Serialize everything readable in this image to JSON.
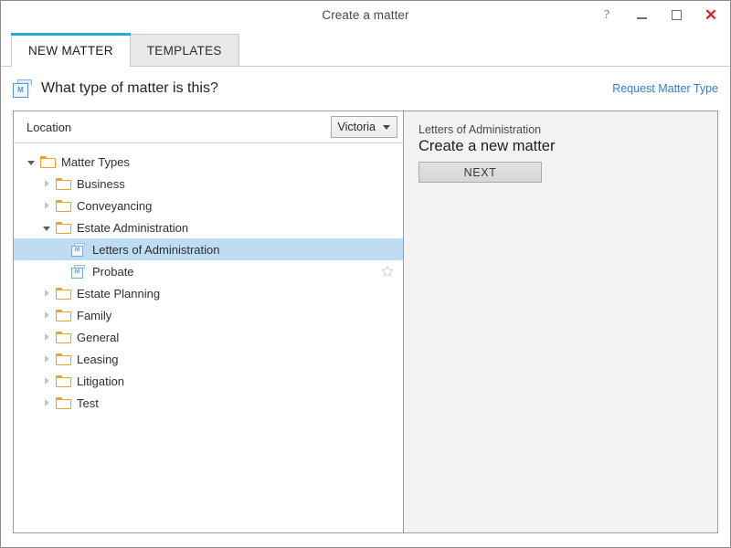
{
  "window": {
    "title": "Create a matter",
    "buttons": {
      "help": "?",
      "minimize": "–",
      "maximize": "□",
      "close": "✕"
    }
  },
  "tabs": [
    {
      "label": "NEW MATTER",
      "active": true
    },
    {
      "label": "TEMPLATES",
      "active": false
    }
  ],
  "header": {
    "icon": "matter-type-icon",
    "icon_letter": "M",
    "title": "What type of matter is this?",
    "link": "Request Matter Type"
  },
  "location": {
    "label": "Location",
    "value": "Victoria"
  },
  "tree": [
    {
      "label": "Matter Types",
      "depth": 0,
      "kind": "folder",
      "state": "expanded",
      "selected": false,
      "star": false
    },
    {
      "label": "Business",
      "depth": 1,
      "kind": "folder",
      "state": "collapsed",
      "selected": false,
      "star": false
    },
    {
      "label": "Conveyancing",
      "depth": 1,
      "kind": "folder",
      "state": "collapsed",
      "selected": false,
      "star": false
    },
    {
      "label": "Estate Administration",
      "depth": 1,
      "kind": "folder",
      "state": "expanded",
      "selected": false,
      "star": false
    },
    {
      "label": "Letters of Administration",
      "depth": 2,
      "kind": "matter",
      "state": "leaf",
      "selected": true,
      "star": true
    },
    {
      "label": "Probate",
      "depth": 2,
      "kind": "matter",
      "state": "leaf",
      "selected": false,
      "star": true
    },
    {
      "label": "Estate Planning",
      "depth": 1,
      "kind": "folder",
      "state": "collapsed",
      "selected": false,
      "star": false
    },
    {
      "label": "Family",
      "depth": 1,
      "kind": "folder",
      "state": "collapsed",
      "selected": false,
      "star": false
    },
    {
      "label": "General",
      "depth": 1,
      "kind": "folder",
      "state": "collapsed",
      "selected": false,
      "star": false
    },
    {
      "label": "Leasing",
      "depth": 1,
      "kind": "folder",
      "state": "collapsed",
      "selected": false,
      "star": false
    },
    {
      "label": "Litigation",
      "depth": 1,
      "kind": "folder",
      "state": "collapsed",
      "selected": false,
      "star": false
    },
    {
      "label": "Test",
      "depth": 1,
      "kind": "folder",
      "state": "collapsed",
      "selected": false,
      "star": false
    }
  ],
  "details": {
    "subtitle": "Letters of Administration",
    "title": "Create a new matter",
    "next_label": "NEXT"
  },
  "colors": {
    "accent_blue": "#29a8e0",
    "link_blue": "#2f7fc4",
    "selection_blue": "#bedcf2",
    "folder_orange": "#f0a028",
    "close_red": "#d9252a",
    "right_pane_bg": "#f3f3f1"
  }
}
